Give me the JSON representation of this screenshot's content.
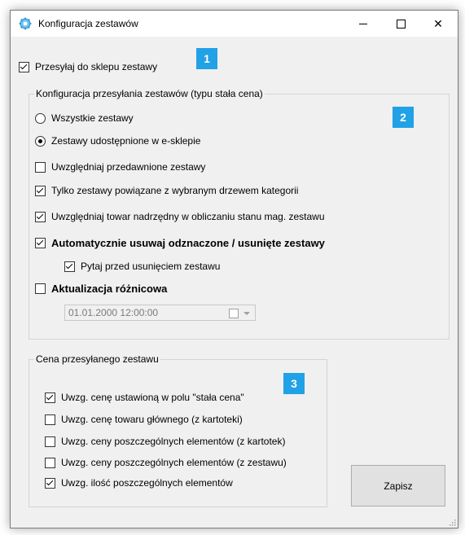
{
  "window": {
    "title": "Konfiguracja zestawów",
    "controls": {
      "minimize": "—",
      "maximize": "☐",
      "close": "✕"
    }
  },
  "top_option": {
    "label": "Przesyłaj do sklepu zestawy",
    "checked": true
  },
  "badges": {
    "b1": "1",
    "b2": "2",
    "b3": "3"
  },
  "config_group": {
    "legend": "Konfiguracja przesyłania zestawów (typu stała cena)",
    "radio_all": {
      "label": "Wszystkie zestawy",
      "checked": false
    },
    "radio_shared": {
      "label": "Zestawy udostępnione w e-sklepie",
      "checked": true
    },
    "opt_expired": {
      "label": "Uwzględniaj przedawnione zestawy",
      "checked": false
    },
    "opt_tree": {
      "label": "Tylko zestawy powiązane z wybranym drzewem kategorii",
      "checked": true
    },
    "opt_parent": {
      "label": "Uwzględniaj towar nadrzędny w obliczaniu stanu mag. zestawu",
      "checked": true
    },
    "opt_autodelete": {
      "label": "Automatycznie usuwaj odznaczone / usunięte zestawy",
      "checked": true
    },
    "opt_ask": {
      "label": "Pytaj przed usunięciem zestawu",
      "checked": true
    },
    "opt_diff": {
      "label": "Aktualizacja różnicowa",
      "checked": false
    },
    "date_value": "01.01.2000 12:00:00"
  },
  "price_group": {
    "legend": "Cena przesyłanego zestawu",
    "opt_fixed": {
      "label": "Uwzg. cenę ustawioną w polu \"stała cena\"",
      "checked": true
    },
    "opt_main": {
      "label": "Uwzg. cenę towaru głównego (z kartoteki)",
      "checked": false
    },
    "opt_elem_cards": {
      "label": "Uwzg. ceny poszczególnych elementów (z kartotek)",
      "checked": false
    },
    "opt_elem_set": {
      "label": "Uwzg. ceny poszczególnych elementów (z zestawu)",
      "checked": false
    },
    "opt_qty": {
      "label": "Uwzg. ilość poszczególnych elementów",
      "checked": true
    }
  },
  "buttons": {
    "save": "Zapisz"
  },
  "colors": {
    "badge": "#21a1e6",
    "window_bg": "#f0f0f0",
    "titlebar": "#ffffff"
  }
}
